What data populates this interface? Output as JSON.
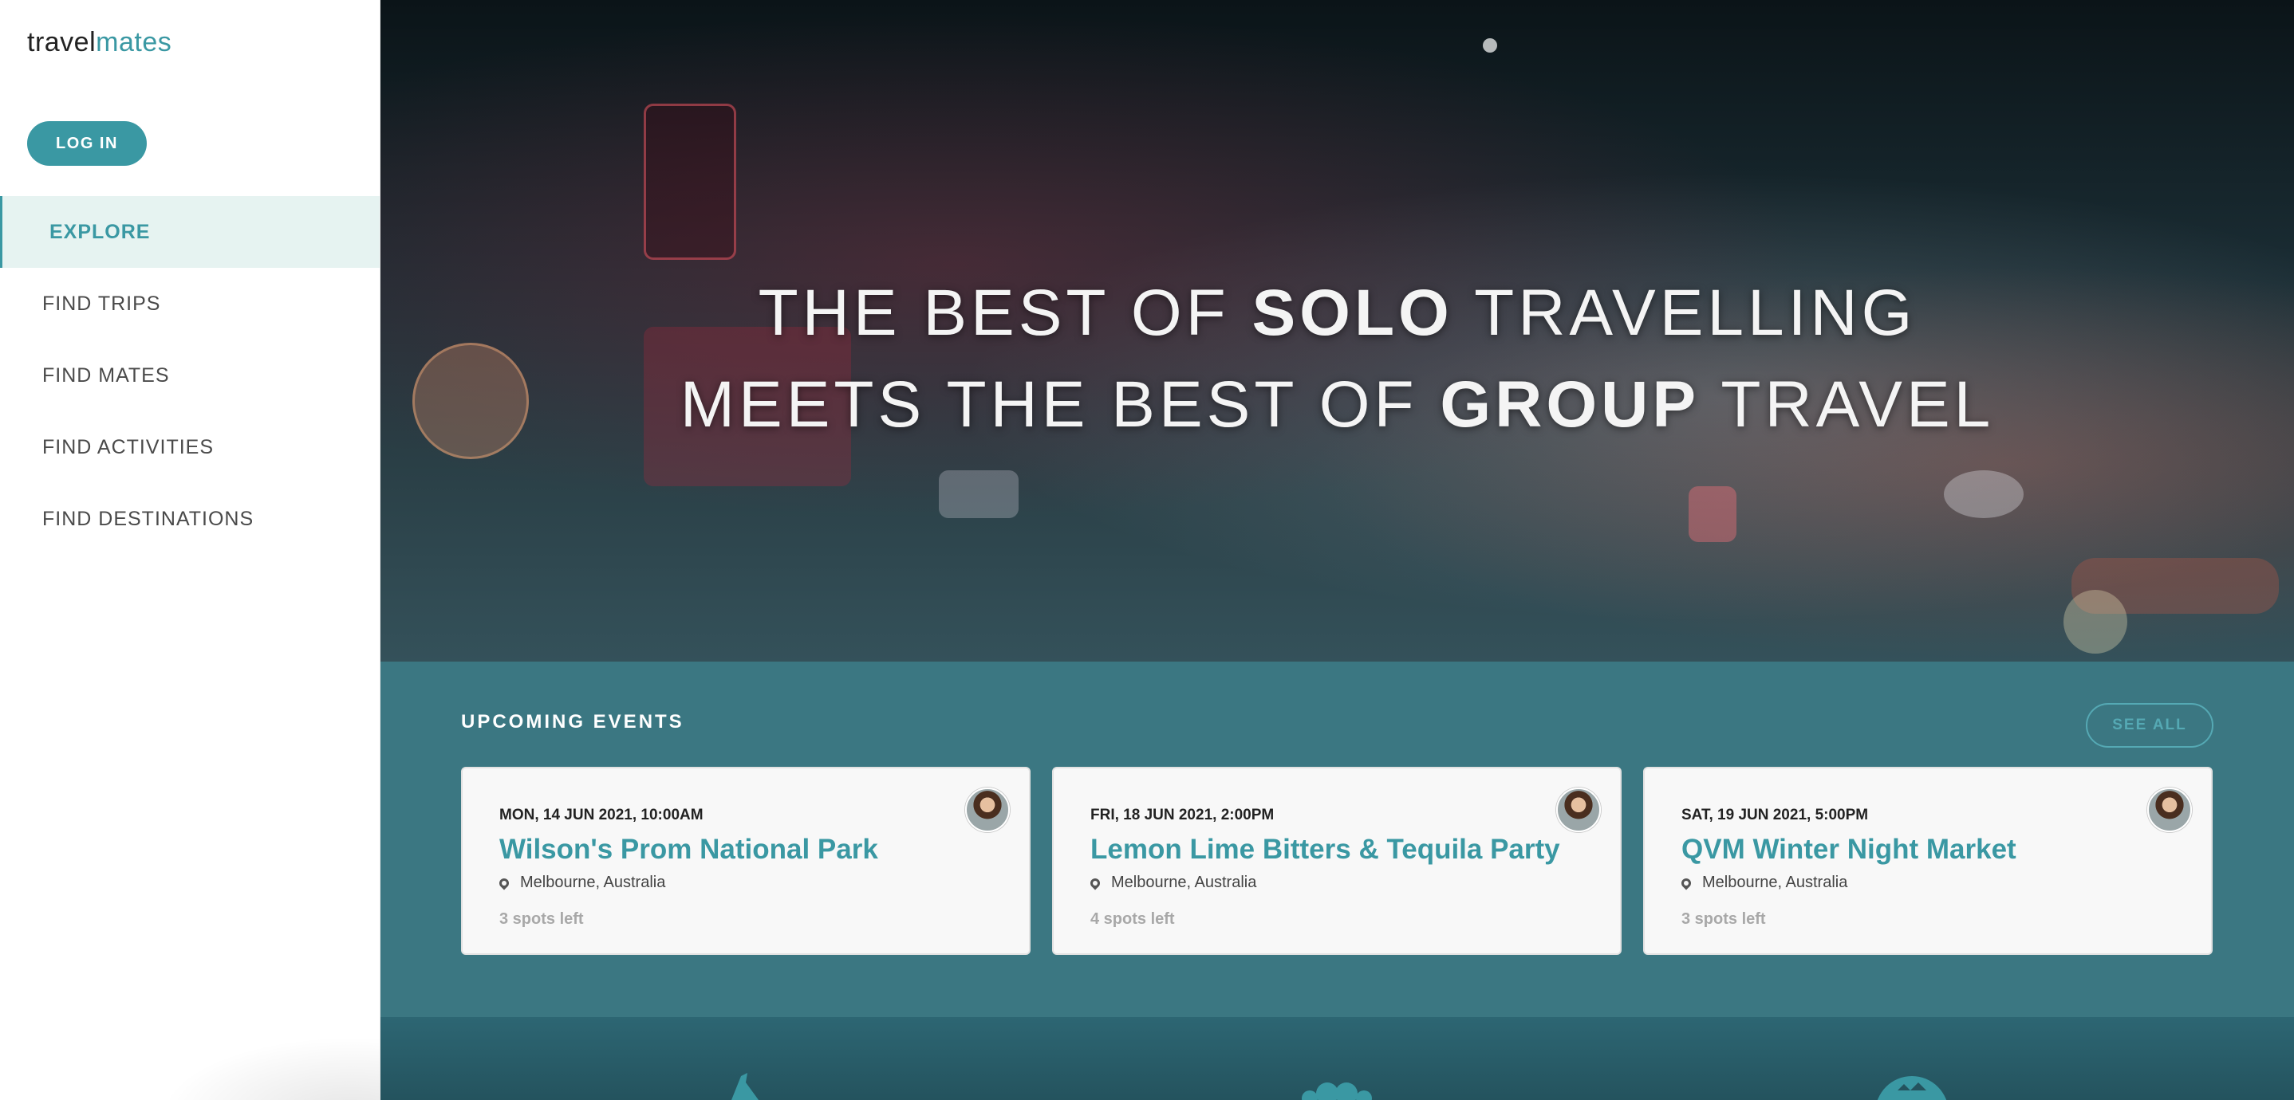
{
  "sidebar": {
    "logo_part1": "travel",
    "logo_part2": "mates",
    "login_label": "LOG IN",
    "nav": [
      {
        "label": "EXPLORE",
        "active": true
      },
      {
        "label": "FIND TRIPS"
      },
      {
        "label": "FIND MATES"
      },
      {
        "label": "FIND ACTIVITIES"
      },
      {
        "label": "FIND DESTINATIONS"
      }
    ]
  },
  "hero": {
    "line1_pre": "THE BEST OF ",
    "line1_bold": "SOLO",
    "line1_post": " TRAVELLING",
    "line2_pre": "MEETS THE BEST OF ",
    "line2_bold": "GROUP",
    "line2_post": " TRAVEL"
  },
  "events": {
    "heading": "UPCOMING EVENTS",
    "see_all_label": "SEE ALL",
    "cards": [
      {
        "date": "MON, 14 JUN 2021, 10:00AM",
        "title": "Wilson's Prom National Park",
        "location": "Melbourne, Australia",
        "spots": "3 spots left"
      },
      {
        "date": "FRI, 18 JUN 2021, 2:00PM",
        "title": "Lemon Lime Bitters & Tequila Party",
        "location": "Melbourne, Australia",
        "spots": "4 spots left"
      },
      {
        "date": "SAT, 19 JUN 2021, 5:00PM",
        "title": "QVM Winter Night Market",
        "location": "Melbourne, Australia",
        "spots": "3 spots left"
      }
    ]
  },
  "colors": {
    "accent": "#3a98a3",
    "events_bg": "#3b7782",
    "nav_active_bg": "#e6f3f1"
  },
  "icons": [
    "location-pin-icon",
    "avatar"
  ]
}
